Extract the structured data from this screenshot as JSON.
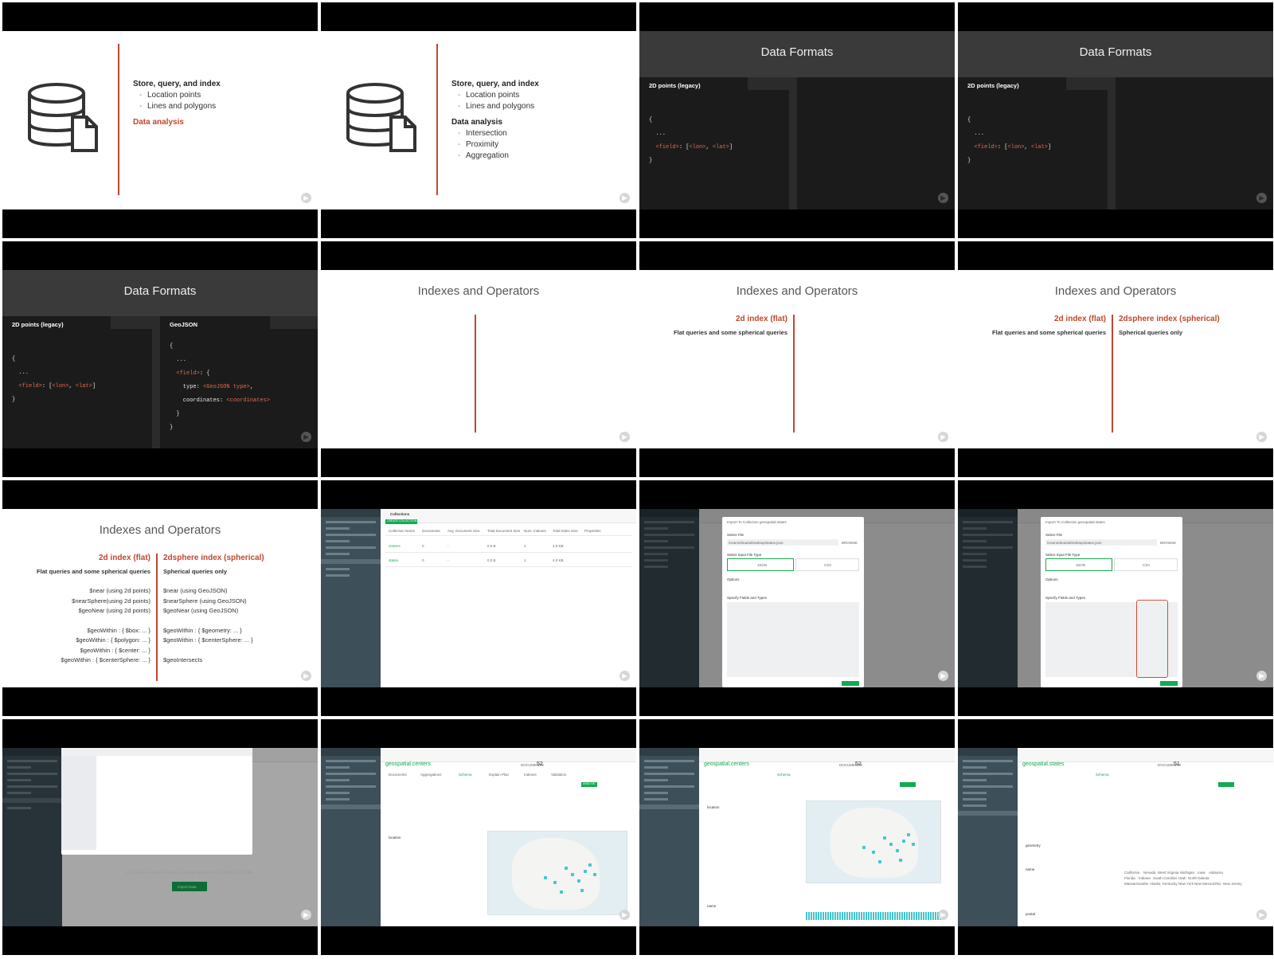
{
  "slides_db": {
    "heading": "Store, query, and index",
    "sub1": "Location points",
    "sub2": "Lines and polygons",
    "analysis": "Data analysis",
    "a1": "Intersection",
    "a2": "Proximity",
    "a3": "Aggregation"
  },
  "formats": {
    "title": "Data Formats",
    "tab_legacy": "2D points (legacy)",
    "tab_geojson": "GeoJSON",
    "code_legacy": [
      "{",
      "  ...",
      "  <field>: [<lon>, <lat>]",
      "}"
    ],
    "code_geo": [
      "{",
      "  ...",
      "  <field>: {",
      "    type: <GeoJSON type>,",
      "    coordinates: <coordinates>",
      "  }",
      "}"
    ]
  },
  "indexes": {
    "title": "Indexes and Operators",
    "flat_head": "2d index (flat)",
    "flat_sub": "Flat queries and some spherical queries",
    "sph_head": "2dsphere index (spherical)",
    "sph_sub": "Spherical queries only",
    "flat_ops": [
      "$near (using 2d points)",
      "$nearSphere(using 2d points)",
      "$geoNear (using 2d points)",
      "",
      "$geoWithin : { $box: ... }",
      "$geoWithin : { $polygon: ... }",
      "$geoWithin : { $center: ... }",
      "$geoWithin : { $centerSphere: ... }"
    ],
    "sph_ops": [
      "$near (using GeoJSON)",
      "$nearSphere (using GeoJSON)",
      "$geoNear (using GeoJSON)",
      "",
      "$geoWithin : { $geometry: ... }",
      "$geoWithin : { $centerSphere: ... }",
      "",
      "$geoIntersects"
    ]
  },
  "compass": {
    "collections_tab": "Collections",
    "create_btn": "CREATE COLLECTION",
    "columns": [
      "Collection Name",
      "Documents",
      "Avg. Document Size",
      "Total Document Size",
      "Num. Indexes",
      "Total Index Size",
      "Properties"
    ],
    "rows": [
      [
        "centers",
        "0",
        "-",
        "0.0 B",
        "1",
        "4.0 KB"
      ],
      [
        "states",
        "0",
        "-",
        "0.0 B",
        "1",
        "4.0 KB"
      ]
    ],
    "import_title": "Import To Collection geospatial.states",
    "select_file": "Select File",
    "file_path": "/Users/dmaria/Desktop/states.json",
    "browse": "BROWSE",
    "file_type": "Select Input File Type",
    "json": "JSON",
    "csv": "CSV",
    "options": "Options",
    "specify": "Specify Fields and Types",
    "empty_title": "This Collection Has No Data",
    "empty_sub": "It only takes a few records to import data from a JSON or CSV file",
    "import_data": "Import Data",
    "centers_ns": "geospatial.centers",
    "states_ns": "geospatial.states",
    "docs_label": "DOCUMENTS",
    "centers_count": "52",
    "states_count": "51",
    "tabs": [
      "Documents",
      "Aggregations",
      "Schema",
      "Explain Plan",
      "Indexes",
      "Validation"
    ],
    "analyze": "ANALYZE",
    "field_location": "location",
    "field_name": "name",
    "field_geometry": "geometry",
    "field_postal": "postal",
    "states_list": [
      "California",
      "Nevada",
      "West Virginia",
      "Michigan",
      "Iowa",
      "Alabama",
      "Florida",
      "Indiana",
      "South Carolina",
      "Utah",
      "North Dakota",
      "Massachusetts",
      "Alaska",
      "Kentucky",
      "New York",
      "New Mexico",
      "Ohio",
      "New Jersey"
    ]
  }
}
